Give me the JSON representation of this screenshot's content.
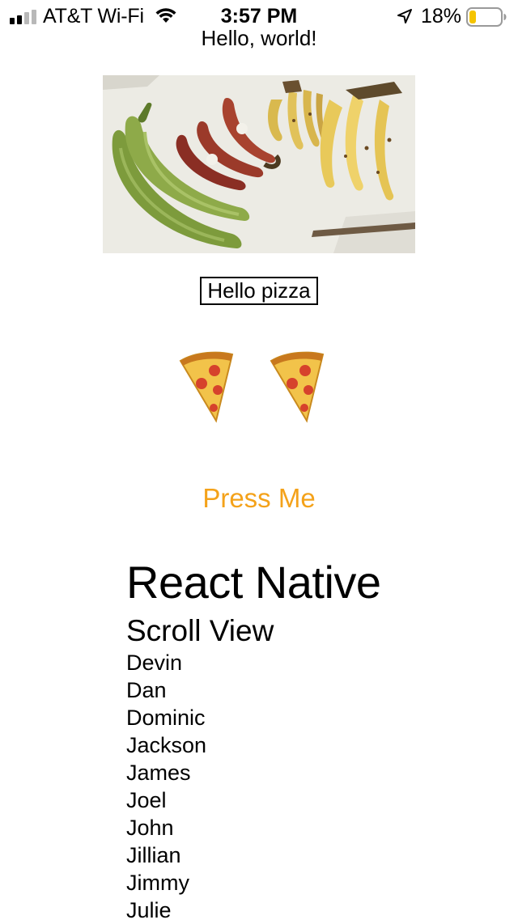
{
  "status_bar": {
    "carrier": "AT&T Wi-Fi",
    "time": "3:57 PM",
    "battery_percent": "18%",
    "battery_level": 0.18,
    "signal_bars_active": 2,
    "signal_bars_total": 4,
    "battery_color": "#f5c400",
    "icons": [
      "signal-bars-icon",
      "wifi-icon",
      "location-arrow-icon",
      "battery-icon"
    ]
  },
  "main": {
    "greeting": "Hello, world!",
    "image": {
      "subject": "bananas",
      "name": "banana-photo"
    },
    "pizza_label": "Hello pizza",
    "pizza_icons": [
      "pizza-slice-icon",
      "pizza-slice-icon"
    ],
    "press_button": {
      "label": "Press Me",
      "color": "#f4a21a"
    },
    "title": "React Native",
    "scroll_heading": "Scroll View",
    "names": [
      "Devin",
      "Dan",
      "Dominic",
      "Jackson",
      "James",
      "Joel",
      "John",
      "Jillian",
      "Jimmy",
      "Julie"
    ]
  }
}
